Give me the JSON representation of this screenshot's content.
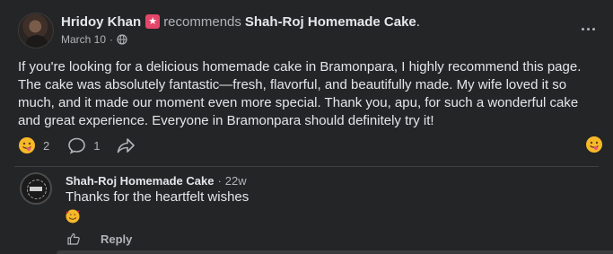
{
  "post": {
    "author": "Hridoy Khan",
    "verb": "recommends",
    "page_name": "Shah-Roj Homemade Cake",
    "period": ".",
    "date": "March 10",
    "separator": "·",
    "body": "If you're looking for a delicious homemade cake in Bramonpara, I highly recommend this page. The cake was absolutely fantastic—fresh, flavorful, and beautifully made. My wife loved it so much, and it made our moment even more special. Thank you, apu, for such a wonderful cake and great experience. Everyone in Bramonpara should definitely try it!",
    "reaction_count": "2",
    "comment_count": "1",
    "icons": {
      "badge": "recommend-star-icon",
      "privacy": "globe-icon",
      "more": "more-options-icon",
      "reaction": "savoring-emoji-icon",
      "comment": "comment-icon",
      "share": "share-icon"
    }
  },
  "reply": {
    "author": "Shah-Roj Homemade Cake",
    "separator": "·",
    "time": "22w",
    "text": "Thanks for the heartfelt wishes",
    "emoji": "smiling-face-with-hearts-icon",
    "like_icon": "thumbs-up-icon",
    "reply_label": "Reply"
  },
  "colors": {
    "background": "#242526",
    "text_primary": "#e4e6eb",
    "text_secondary": "#b0b3b8",
    "badge": "#e4466a"
  }
}
